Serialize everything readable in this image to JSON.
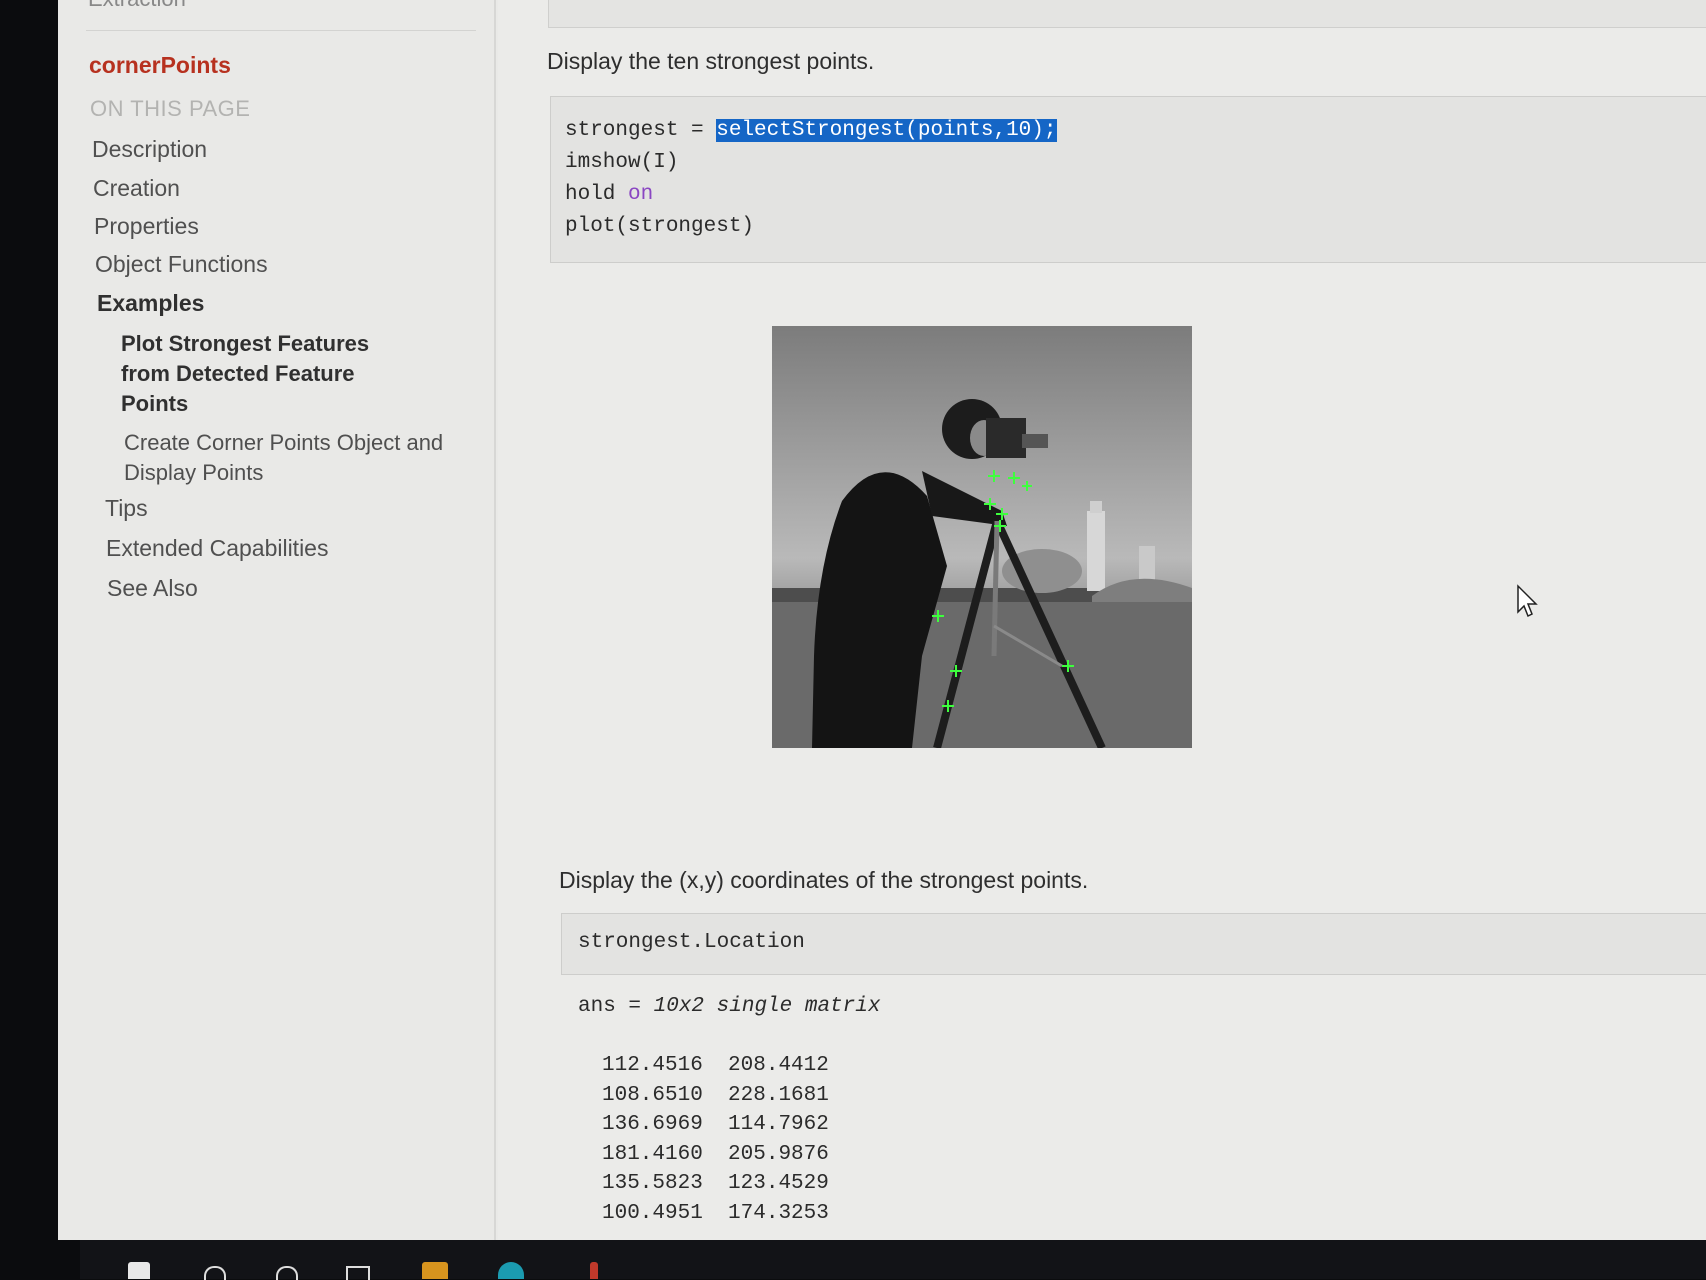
{
  "sidebar": {
    "cut_heading": "Extraction",
    "title": "cornerPoints",
    "on_this_page": "ON THIS PAGE",
    "items": {
      "description": "Description",
      "creation": "Creation",
      "properties": "Properties",
      "object_functions": "Object Functions",
      "examples": "Examples",
      "example1": "Plot Strongest Features from Detected Feature Points",
      "example2": "Create Corner Points Object and Display Points",
      "tips": "Tips",
      "extended": "Extended Capabilities",
      "see_also": "See Also"
    }
  },
  "main": {
    "intro_text": "Display the ten strongest points.",
    "code1": {
      "line1_prefix": "strongest = ",
      "line1_highlight": "selectStrongest(points,10);",
      "line2": "imshow(I)",
      "line3_prefix": "hold ",
      "line3_keyword": "on",
      "line4": "plot(strongest)"
    },
    "coords_text": "Display the (x,y) coordinates of the strongest points.",
    "code2": "strongest.Location",
    "output": {
      "header_prefix": "ans = ",
      "header_type": "10x2 single matrix",
      "rows": [
        [
          "112.4516",
          "208.4412"
        ],
        [
          "108.6510",
          "228.1681"
        ],
        [
          "136.6969",
          "114.7962"
        ],
        [
          "181.4160",
          "205.9876"
        ],
        [
          "135.5823",
          "123.4529"
        ],
        [
          "100.4951",
          "174.3253"
        ]
      ]
    },
    "image_alt": "cameraman image with strongest feature points"
  },
  "colors": {
    "title_red": "#b7311f",
    "selection_blue": "#1566c6",
    "keyword_purple": "#8a46c2",
    "marker_green": "#3dff3d"
  }
}
